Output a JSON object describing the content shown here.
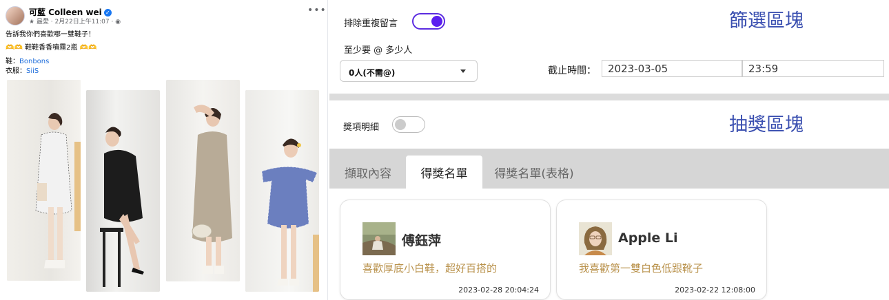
{
  "post": {
    "author": "可藍 Colleen wei",
    "meta": "最愛 · 2月22日上午11:07 · ",
    "line1": "告訴我你們喜歡哪一雙鞋子！",
    "line2_emoji": "🫶🫶",
    "line2": " 鞋鞋香香噴霧2瓶",
    "line2_emoji_end": "🫶🫶",
    "shoes_label": "鞋：",
    "shoes_link": "Bonbons",
    "clothes_label": "衣服：",
    "clothes_link": "SiiS"
  },
  "filter": {
    "title": "篩選區塊",
    "exclude_dup_label": "排除重複留言",
    "exclude_dup_on": true,
    "min_tag_label": "至少要 @ 多少人",
    "min_tag_value": "0人(不需@)",
    "deadline_label": "截止時間：",
    "deadline_date": "2023-03-05",
    "deadline_time": "23:59"
  },
  "draw": {
    "title": "抽獎區塊",
    "prize_detail_label": "獎項明細",
    "prize_detail_on": false,
    "tabs": [
      "擷取內容",
      "得獎名單",
      "得獎名單(表格)"
    ],
    "active_tab": 1
  },
  "winners": [
    {
      "name": "傅鈺萍",
      "comment": "喜歡厚底小白鞋，超好百搭的",
      "time": "2023-02-28 20:04:24"
    },
    {
      "name": "Apple Li",
      "comment": "我喜歡第一雙白色低跟靴子",
      "time": "2023-02-22 12:08:00"
    }
  ],
  "colors": {
    "accent": "#5b1ef0",
    "section_title": "#3a4fb0",
    "comment": "#b9924c",
    "link": "#216fdb"
  }
}
